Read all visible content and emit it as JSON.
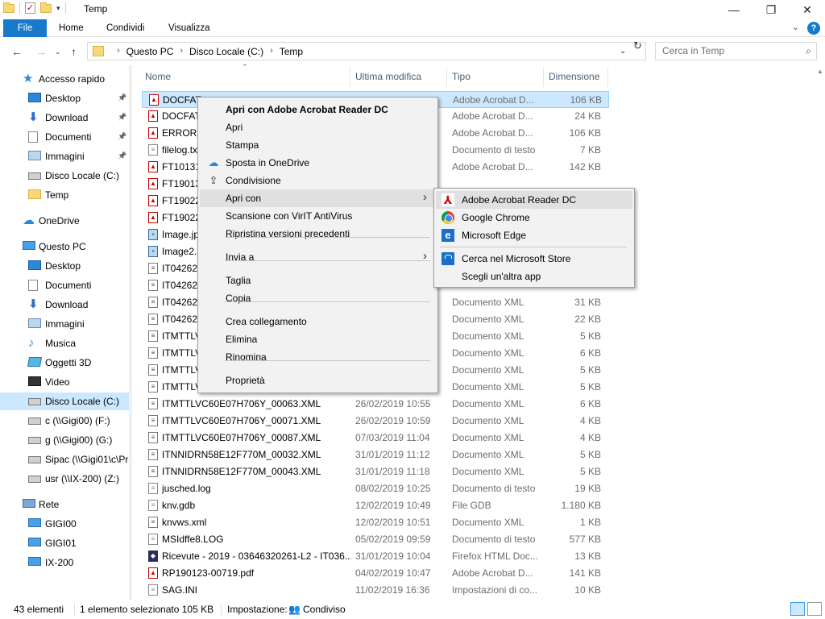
{
  "window": {
    "title": "Temp",
    "minimize_icon": "minimize-icon",
    "maximize_icon": "restore-icon",
    "close_icon": "close-icon"
  },
  "ribbon": {
    "tabs": [
      "File",
      "Home",
      "Condividi",
      "Visualizza"
    ],
    "accent": "#1979ca"
  },
  "address": {
    "crumbs": [
      "Questo PC",
      "Disco Locale (C:)",
      "Temp"
    ],
    "search_placeholder": "Cerca in Temp"
  },
  "nav": {
    "items": [
      {
        "label": "Accesso rapido",
        "icon": "star-icon",
        "level": 0,
        "pinned": false
      },
      {
        "label": "Desktop",
        "icon": "desktop-icon",
        "level": 1,
        "pinned": true
      },
      {
        "label": "Download",
        "icon": "download-icon",
        "level": 1,
        "pinned": true
      },
      {
        "label": "Documenti",
        "icon": "documents-icon",
        "level": 1,
        "pinned": true
      },
      {
        "label": "Immagini",
        "icon": "pictures-icon",
        "level": 1,
        "pinned": true
      },
      {
        "label": "Disco Locale (C:)",
        "icon": "drive-icon",
        "level": 1,
        "pinned": false
      },
      {
        "label": "Temp",
        "icon": "folder-icon",
        "level": 1,
        "pinned": false
      },
      {
        "label": "OneDrive",
        "icon": "cloud-icon",
        "level": 0,
        "pinned": false
      },
      {
        "label": "Questo PC",
        "icon": "computer-icon",
        "level": 0,
        "pinned": false
      },
      {
        "label": "Desktop",
        "icon": "desktop-icon",
        "level": 1,
        "pinned": false
      },
      {
        "label": "Documenti",
        "icon": "documents-icon",
        "level": 1,
        "pinned": false
      },
      {
        "label": "Download",
        "icon": "download-icon",
        "level": 1,
        "pinned": false
      },
      {
        "label": "Immagini",
        "icon": "pictures-icon",
        "level": 1,
        "pinned": false
      },
      {
        "label": "Musica",
        "icon": "music-icon",
        "level": 1,
        "pinned": false
      },
      {
        "label": "Oggetti 3D",
        "icon": "objects3d-icon",
        "level": 1,
        "pinned": false
      },
      {
        "label": "Video",
        "icon": "video-icon",
        "level": 1,
        "pinned": false
      },
      {
        "label": "Disco Locale (C:)",
        "icon": "drive-icon",
        "level": 1,
        "pinned": false,
        "selected": true
      },
      {
        "label": "c (\\\\Gigi00) (F:)",
        "icon": "network-drive-icon",
        "level": 1,
        "pinned": false
      },
      {
        "label": "g (\\\\Gigi00) (G:)",
        "icon": "network-drive-icon",
        "level": 1,
        "pinned": false
      },
      {
        "label": "Sipac (\\\\Gigi01\\c\\Pr",
        "icon": "network-drive-icon",
        "level": 1,
        "pinned": false
      },
      {
        "label": "usr (\\\\IX-200) (Z:)",
        "icon": "network-drive-icon",
        "level": 1,
        "pinned": false
      },
      {
        "label": "Rete",
        "icon": "network-icon",
        "level": 0,
        "pinned": false
      },
      {
        "label": "GIGI00",
        "icon": "computer-icon",
        "level": 1,
        "pinned": false
      },
      {
        "label": "GIGI01",
        "icon": "computer-icon",
        "level": 1,
        "pinned": false
      },
      {
        "label": "IX-200",
        "icon": "computer-icon",
        "level": 1,
        "pinned": false
      }
    ]
  },
  "columns": {
    "name": "Nome",
    "modified": "Ultima modifica",
    "type": "Tipo",
    "size": "Dimensione"
  },
  "files": [
    {
      "name": "DOCFAT",
      "date": "",
      "type": "Adobe Acrobat D...",
      "size": "106 KB",
      "icon": "pdf",
      "selected": true
    },
    {
      "name": "DOCFAT",
      "date": "",
      "type": "Adobe Acrobat D...",
      "size": "24 KB",
      "icon": "pdf"
    },
    {
      "name": "ERRORE",
      "date": "",
      "type": "Adobe Acrobat D...",
      "size": "106 KB",
      "icon": "pdf"
    },
    {
      "name": "filelog.tx",
      "date": "",
      "type": "Documento di testo",
      "size": "7 KB",
      "icon": "txt"
    },
    {
      "name": "FT10131",
      "date": "",
      "type": "Adobe Acrobat D...",
      "size": "142 KB",
      "icon": "pdf"
    },
    {
      "name": "FT19013",
      "date": "",
      "type": "",
      "size": "",
      "icon": "pdf"
    },
    {
      "name": "FT19022",
      "date": "",
      "type": "",
      "size": "",
      "icon": "pdf"
    },
    {
      "name": "FT19022",
      "date": "",
      "type": "",
      "size": "",
      "icon": "pdf"
    },
    {
      "name": "Image.jp",
      "date": "",
      "type": "",
      "size": "",
      "icon": "img"
    },
    {
      "name": "Image2.",
      "date": "",
      "type": "",
      "size": "",
      "icon": "img"
    },
    {
      "name": "IT042624",
      "date": "",
      "type": "",
      "size": "",
      "icon": "xml"
    },
    {
      "name": "IT042624",
      "date": "",
      "type": "",
      "size": "",
      "icon": "xml"
    },
    {
      "name": "IT042624",
      "date": "",
      "type": "Documento XML",
      "size": "31 KB",
      "icon": "xml"
    },
    {
      "name": "IT042624",
      "date": "",
      "type": "Documento XML",
      "size": "22 KB",
      "icon": "xml"
    },
    {
      "name": "ITMTTLV",
      "date": "",
      "type": "Documento XML",
      "size": "5 KB",
      "icon": "xml"
    },
    {
      "name": "ITMTTLV",
      "date": "",
      "type": "Documento XML",
      "size": "6 KB",
      "icon": "xml"
    },
    {
      "name": "ITMTTLV",
      "date": "",
      "type": "Documento XML",
      "size": "5 KB",
      "icon": "xml"
    },
    {
      "name": "ITMTTLV",
      "date": "",
      "type": "Documento XML",
      "size": "5 KB",
      "icon": "xml"
    },
    {
      "name": "ITMTTLVC60E07H706Y_00063.XML",
      "date": "26/02/2019 10:55",
      "type": "Documento XML",
      "size": "6 KB",
      "icon": "xml"
    },
    {
      "name": "ITMTTLVC60E07H706Y_00071.XML",
      "date": "26/02/2019 10:59",
      "type": "Documento XML",
      "size": "4 KB",
      "icon": "xml"
    },
    {
      "name": "ITMTTLVC60E07H706Y_00087.XML",
      "date": "07/03/2019 11:04",
      "type": "Documento XML",
      "size": "4 KB",
      "icon": "xml"
    },
    {
      "name": "ITNNIDRN58E12F770M_00032.XML",
      "date": "31/01/2019 11:12",
      "type": "Documento XML",
      "size": "5 KB",
      "icon": "xml"
    },
    {
      "name": "ITNNIDRN58E12F770M_00043.XML",
      "date": "31/01/2019 11:18",
      "type": "Documento XML",
      "size": "5 KB",
      "icon": "xml"
    },
    {
      "name": "jusched.log",
      "date": "08/02/2019 10:25",
      "type": "Documento di testo",
      "size": "19 KB",
      "icon": "txt"
    },
    {
      "name": "knv.gdb",
      "date": "12/02/2019 10:49",
      "type": "File GDB",
      "size": "1.180 KB",
      "icon": "txt"
    },
    {
      "name": "knvws.xml",
      "date": "12/02/2019 10:51",
      "type": "Documento XML",
      "size": "1 KB",
      "icon": "xml"
    },
    {
      "name": "MSIdffe8.LOG",
      "date": "05/02/2019 09:59",
      "type": "Documento di testo",
      "size": "577 KB",
      "icon": "txt"
    },
    {
      "name": "Ricevute - 2019 - 03646320261-L2 - IT036...",
      "date": "31/01/2019 10:04",
      "type": "Firefox HTML Doc...",
      "size": "13 KB",
      "icon": "htm"
    },
    {
      "name": "RP190123-00719.pdf",
      "date": "04/02/2019 10:47",
      "type": "Adobe Acrobat D...",
      "size": "141 KB",
      "icon": "pdf"
    },
    {
      "name": "SAG.INI",
      "date": "11/02/2019 16:36",
      "type": "Impostazioni di co...",
      "size": "10 KB",
      "icon": "txt"
    }
  ],
  "context_menu": {
    "items": [
      {
        "label": "Apri con Adobe Acrobat Reader DC",
        "bold": true
      },
      {
        "label": "Apri"
      },
      {
        "label": "Stampa"
      },
      {
        "label": "Sposta in OneDrive",
        "icon": "onedrive-icon"
      },
      {
        "label": "Condivisione",
        "icon": "share-icon"
      },
      {
        "label": "Apri con",
        "submenu": true,
        "highlighted": true
      },
      {
        "label": "Scansione con VirIT AntiVirus"
      },
      {
        "label": "Ripristina versioni precedenti"
      },
      {
        "label": "Invia a",
        "submenu": true
      },
      {
        "label": "Taglia"
      },
      {
        "label": "Copia"
      },
      {
        "label": "Crea collegamento"
      },
      {
        "label": "Elimina"
      },
      {
        "label": "Rinomina"
      },
      {
        "label": "Proprietà"
      }
    ]
  },
  "submenu": {
    "items": [
      {
        "label": "Adobe Acrobat Reader DC",
        "icon": "acrobat-icon",
        "highlighted": true
      },
      {
        "label": "Google Chrome",
        "icon": "chrome-icon"
      },
      {
        "label": "Microsoft Edge",
        "icon": "edge-icon"
      },
      {
        "label": "Cerca nel Microsoft Store",
        "icon": "store-icon"
      },
      {
        "label": "Scegli un'altra app",
        "icon": ""
      }
    ]
  },
  "status": {
    "count": "43 elementi",
    "selection": "1 elemento selezionato  105 KB",
    "setting_label": "Impostazione:",
    "setting_value": "Condiviso"
  }
}
